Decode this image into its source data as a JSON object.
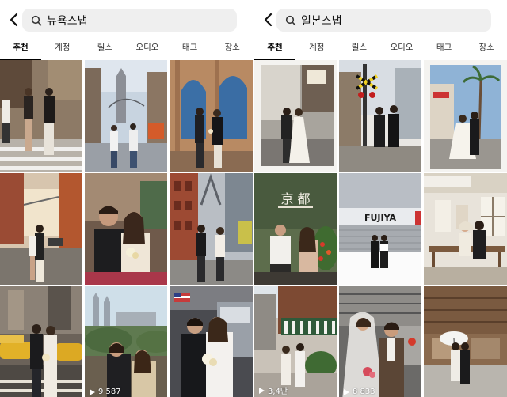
{
  "panels": [
    {
      "search_query": "뉴욕스냅",
      "tabs": [
        "추천",
        "계정",
        "릴스",
        "오디오",
        "태그",
        "장소"
      ],
      "active_tab": "추천",
      "tiles": [
        {
          "name": "street-couple-photo"
        },
        {
          "name": "bridge-couple-photo"
        },
        {
          "name": "blue-arch-couple-photo"
        },
        {
          "name": "brooklyn-street-photo"
        },
        {
          "name": "couple-closeup-photo"
        },
        {
          "name": "red-building-couple-photo"
        },
        {
          "name": "taxi-couple-photo"
        },
        {
          "name": "central-park-couple-photo",
          "views": "9 587"
        },
        {
          "name": "subway-wedding-photo"
        }
      ]
    },
    {
      "search_query": "일본스냅",
      "tabs": [
        "추천",
        "계정",
        "릴스",
        "오디오",
        "태그",
        "장소"
      ],
      "active_tab": "추천",
      "tiles": [
        {
          "name": "japan-street-couple-photo"
        },
        {
          "name": "railway-crossing-photo"
        },
        {
          "name": "palm-street-photo"
        },
        {
          "name": "kyoto-sign-photo",
          "sign_text": "京 都"
        },
        {
          "name": "fujiya-snow-photo",
          "sign_text": "FUJIYA"
        },
        {
          "name": "japanese-house-photo"
        },
        {
          "name": "market-street-photo",
          "views": "3,4만"
        },
        {
          "name": "veil-couple-photo",
          "views": "8 833"
        },
        {
          "name": "umbrella-couple-photo"
        }
      ]
    }
  ]
}
